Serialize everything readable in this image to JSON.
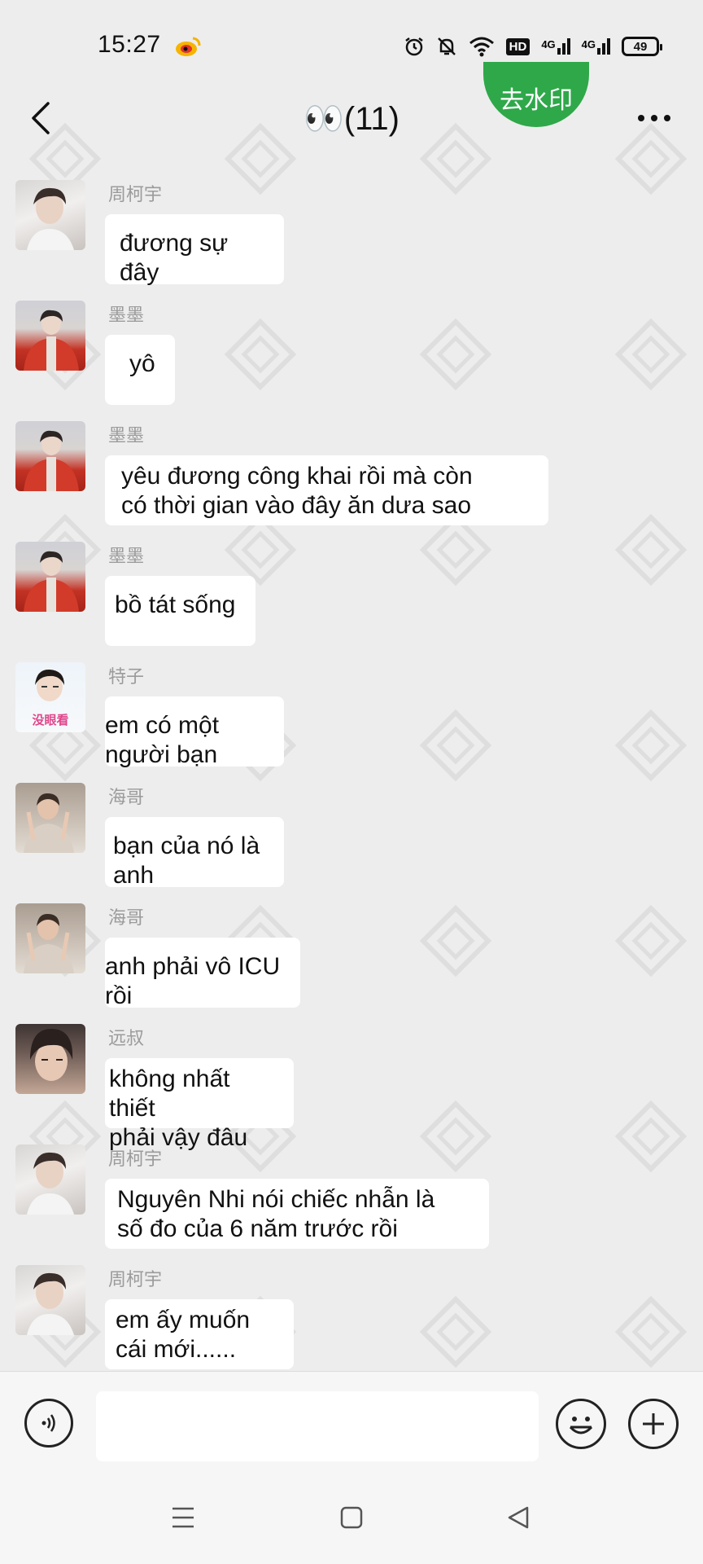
{
  "status_bar": {
    "time": "15:27",
    "network1": "4G",
    "network2": "4G",
    "hd_label": "HD",
    "battery": "49"
  },
  "header": {
    "title": "👀(11)",
    "watermark_button": "去水印"
  },
  "messages": [
    {
      "sender": "周柯宇",
      "text": "đương sự đây",
      "avatar": "avatar-a"
    },
    {
      "sender": "墨墨",
      "text": "yô",
      "avatar": "avatar-b"
    },
    {
      "sender": "墨墨",
      "text": "yêu đương công khai rồi mà còn\ncó thời gian vào đây ăn dưa sao",
      "avatar": "avatar-b"
    },
    {
      "sender": "墨墨",
      "text": "bồ tát sống",
      "avatar": "avatar-b"
    },
    {
      "sender": "特子",
      "text": "em có một người bạn",
      "avatar": "avatar-c",
      "avatar_caption": "没眼看"
    },
    {
      "sender": "海哥",
      "text": "bạn của nó là anh",
      "avatar": "avatar-d"
    },
    {
      "sender": "海哥",
      "text": "anh phải vô ICU rồi",
      "avatar": "avatar-d"
    },
    {
      "sender": "远叔",
      "text": "không nhất thiết\nphải vậy đâu",
      "avatar": "avatar-e"
    },
    {
      "sender": "周柯宇",
      "text": "Nguyên Nhi nói chiếc nhẫn là\nsố đo của 6 năm trước rồi",
      "avatar": "avatar-a"
    },
    {
      "sender": "周柯宇",
      "text": "em ấy muốn\ncái mới......",
      "avatar": "avatar-a"
    }
  ],
  "colors": {
    "background": "#ededed",
    "bubble": "#ffffff",
    "accent_green": "#2fa84a",
    "sender_gray": "#9b9b9b"
  },
  "icons": [
    "back-arrow-icon",
    "more-dots-icon",
    "voice-icon",
    "emoji-icon",
    "plus-icon",
    "menu-icon",
    "home-square-icon",
    "back-triangle-icon",
    "wifi-icon",
    "alarm-icon",
    "mute-bell-icon",
    "weibo-icon"
  ]
}
